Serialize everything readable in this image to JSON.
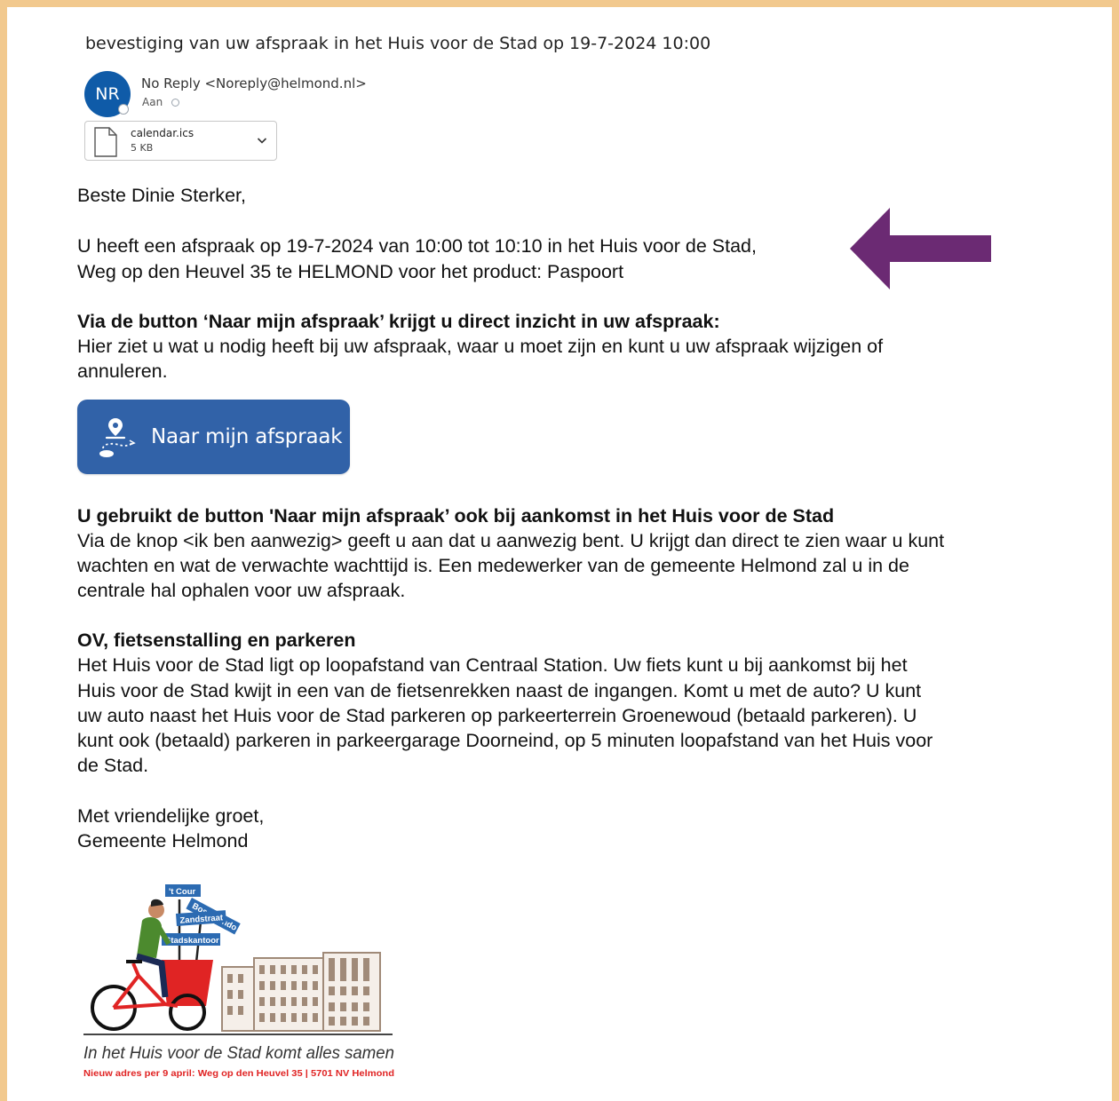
{
  "email": {
    "subject": "bevestiging van uw afspraak in het Huis voor de Stad op 19-7-2024 10:00",
    "sender_initials": "NR",
    "sender": "No Reply <Noreply@helmond.nl>",
    "to_label": "Aan",
    "attachment": {
      "name": "calendar.ics",
      "size": "5 KB",
      "icon": "document-icon"
    }
  },
  "body": {
    "greeting": "Beste Dinie Sterker,",
    "appointment_line1": "U heeft een afspraak op 19-7-2024 van 10:00 tot 10:10 in het Huis voor de Stad,",
    "appointment_line2": "Weg op den Heuvel 35 te HELMOND voor het product: Paspoort",
    "section1_title": "Via de button ‘Naar mijn afspraak’ krijgt u direct inzicht in uw afspraak:",
    "section1_text_line1": "Hier ziet u wat u nodig heeft bij uw afspraak, waar u moet zijn en kunt u uw afspraak wijzigen of",
    "section1_text_line2": "annuleren.",
    "cta_label": "Naar mijn afspraak",
    "cta_icon": "location-route-icon",
    "section2_title": "U gebruikt de button 'Naar mijn afspraak’ ook bij aankomst in het Huis voor de Stad",
    "section2_line1": "Via de knop <ik ben aanwezig> geeft u aan dat u aanwezig bent. U krijgt dan direct te zien waar u kunt",
    "section2_line2": "wachten en wat de verwachte wachttijd is. Een medewerker van de gemeente Helmond zal u in de",
    "section2_line3": "centrale hal ophalen voor uw afspraak.",
    "section3_title": "OV, fietsenstalling en parkeren",
    "section3_line1": "Het Huis voor de Stad ligt op loopafstand van Centraal Station. Uw fiets kunt u bij aankomst bij het",
    "section3_line2": "Huis voor de Stad kwijt in een van de fietsenrekken naast de ingangen. Komt u met de auto? U kunt",
    "section3_line3": "uw auto naast het Huis voor de Stad parkeren op parkeerterrein Groenewoud (betaald parkeren). U",
    "section3_line4": "kunt ook (betaald) parkeren in parkeergarage Doorneind, op 5 minuten loopafstand van het Huis voor",
    "section3_line5": "de Stad.",
    "closing": "Met vriendelijke groet,",
    "signature": "Gemeente Helmond"
  },
  "logo": {
    "signs": [
      "'t Cour",
      "Boscotondo",
      "Zandstraat",
      "Stadskantoor"
    ],
    "tagline": "In het Huis voor de Stad komt alles samen",
    "subline": "Nieuw adres per 9 april: Weg op den Heuvel 35 | 5701 NV Helmond"
  },
  "colors": {
    "frame": "#f2c98e",
    "avatar": "#0f5ba8",
    "cta": "#3162a8",
    "arrow": "#6b2a73",
    "logo_red": "#e02424"
  }
}
